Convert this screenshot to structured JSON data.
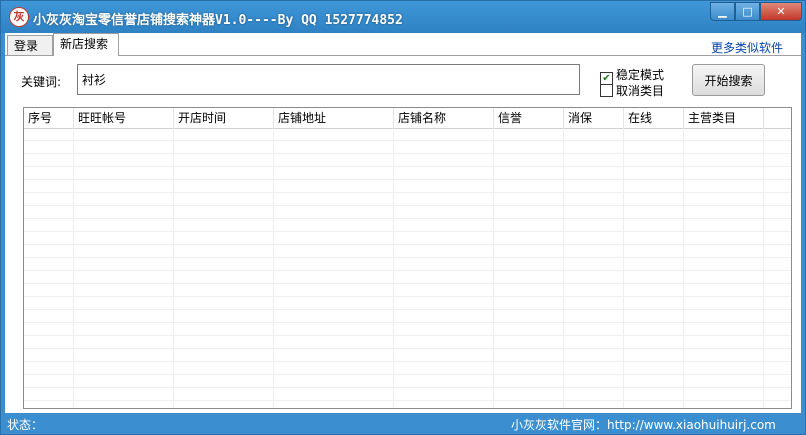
{
  "window": {
    "title": "小灰灰淘宝零信誉店铺搜索神器V1.0----By QQ 1527774852",
    "controls": {
      "minimize": "▁",
      "maximize": "□",
      "close": "✕"
    }
  },
  "tabs": [
    {
      "label": "登录"
    },
    {
      "label": "新店搜索"
    }
  ],
  "more_link": "更多类似软件",
  "search": {
    "label": "关键词:",
    "value": "衬衫",
    "stable_mode": {
      "label": "稳定模式",
      "checked": true
    },
    "cancel_category": {
      "label": "取消类目",
      "checked": false
    },
    "start_button": "开始搜索"
  },
  "table": {
    "columns": [
      "序号",
      "旺旺帐号",
      "开店时间",
      "店铺地址",
      "店铺名称",
      "信誉",
      "消保",
      "在线",
      "主营类目"
    ],
    "rows": []
  },
  "status": {
    "left": "状态：",
    "right": "小灰灰软件官网：http://www.xiaohuihuirj.com"
  },
  "colors": {
    "titlebar": "#3b8fd0",
    "statusbar": "#3b8fd0",
    "link": "#0645ad"
  }
}
